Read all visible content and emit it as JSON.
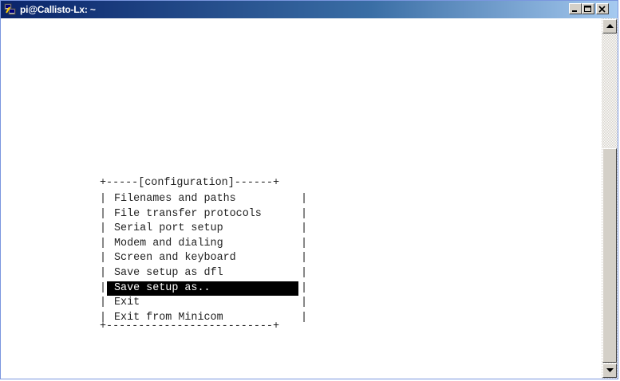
{
  "window": {
    "title": "pi@Callisto-Lx: ~",
    "controls": [
      "minimize",
      "maximize",
      "close"
    ]
  },
  "menu": {
    "top_border": "+-----[configuration]------+",
    "bottom_border": "+--------------------------+",
    "side_char": "|",
    "selected_index": 6,
    "items": [
      {
        "label": "Filenames and paths"
      },
      {
        "label": "File transfer protocols"
      },
      {
        "label": "Serial port setup"
      },
      {
        "label": "Modem and dialing"
      },
      {
        "label": "Screen and keyboard"
      },
      {
        "label": "Save setup as dfl"
      },
      {
        "label": "Save setup as.."
      },
      {
        "label": "Exit"
      },
      {
        "label": "Exit from Minicom"
      }
    ]
  },
  "icons": {
    "title_icon": "putty-icon",
    "minimize": "minimize-icon",
    "maximize": "maximize-icon",
    "close": "close-icon",
    "scroll_up": "arrow-up-icon",
    "scroll_down": "arrow-down-icon"
  }
}
